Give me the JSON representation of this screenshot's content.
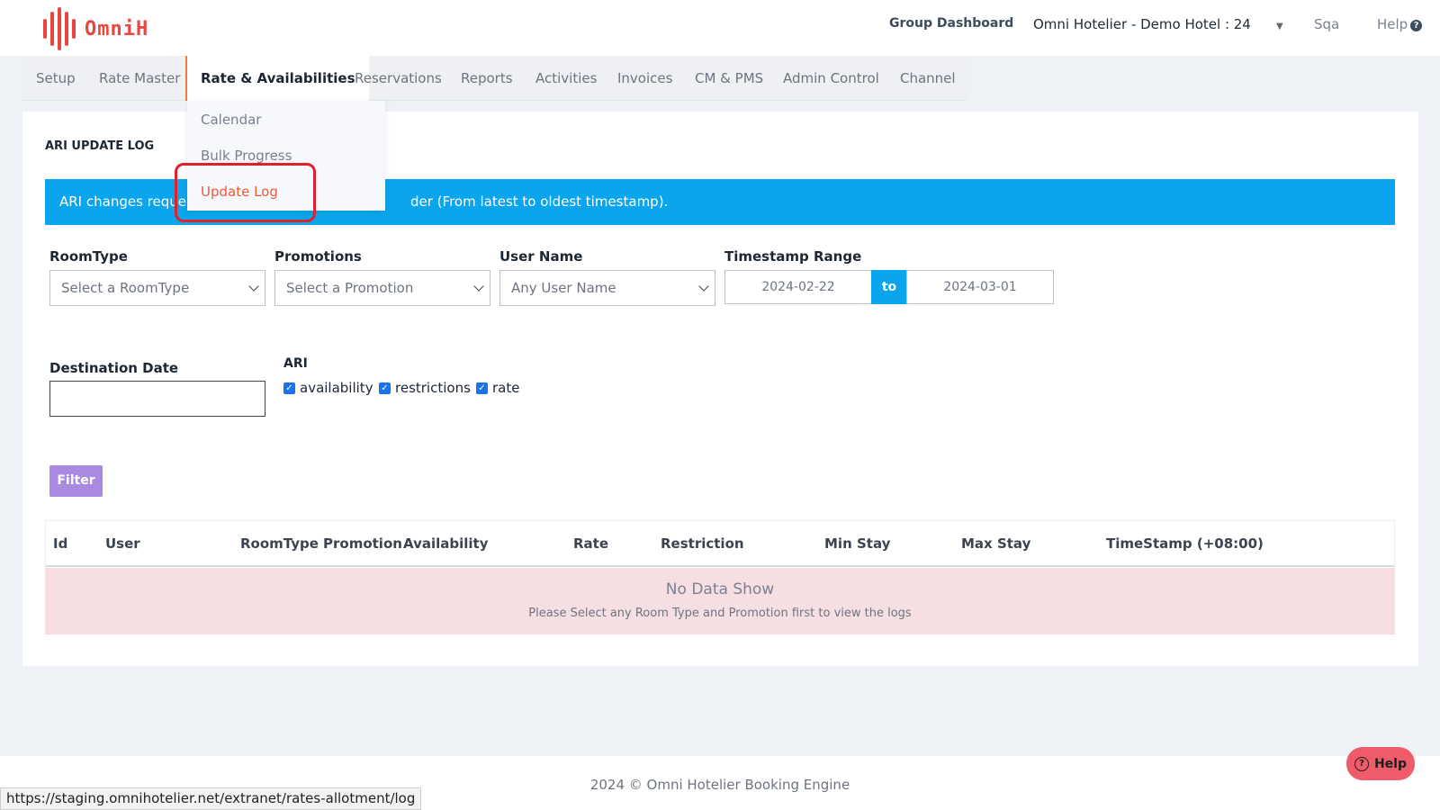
{
  "header": {
    "brand": "OmniH",
    "group_dashboard": "Group Dashboard",
    "hotel_selector": "Omni Hotelier - Demo Hotel : 24",
    "user": "Sqa",
    "help": "Help"
  },
  "nav": {
    "items": [
      "Setup",
      "Rate Master",
      "Rate & Availabilities",
      "Reservations",
      "Reports",
      "Activities",
      "Invoices",
      "CM & PMS",
      "Admin Control",
      "Channel"
    ],
    "active": "Rate & Availabilities"
  },
  "dropdown": {
    "items": [
      "Calendar",
      "Bulk Progress",
      "Update Log"
    ],
    "selected": "Update Log"
  },
  "page": {
    "title": "ARI UPDATE LOG",
    "info_visible_start": "ARI changes reque",
    "info_visible_end": "der (From latest to oldest timestamp)."
  },
  "filters": {
    "roomtype_label": "RoomType",
    "roomtype_value": "Select a RoomType",
    "promotions_label": "Promotions",
    "promotions_value": "Select a Promotion",
    "username_label": "User Name",
    "username_value": "Any User Name",
    "timestamp_label": "Timestamp Range",
    "date_from": "2024-02-22",
    "date_to_label": "to",
    "date_to": "2024-03-01",
    "destination_label": "Destination Date",
    "destination_value": "",
    "ari_label": "ARI",
    "ari_checks": [
      {
        "label": "availability",
        "checked": true
      },
      {
        "label": "restrictions",
        "checked": true
      },
      {
        "label": "rate",
        "checked": true
      }
    ],
    "filter_button": "Filter"
  },
  "table": {
    "columns": [
      "Id",
      "User",
      "RoomType",
      "Promotion",
      "Availability",
      "Rate",
      "Restriction",
      "Min Stay",
      "Max Stay",
      "TimeStamp (+08:00)"
    ],
    "empty_title": "No Data Show",
    "empty_subtitle": "Please Select any Room Type and Promotion first to view the logs"
  },
  "footer": {
    "text": "2024 © Omni Hotelier Booking Engine",
    "status_url": "https://staging.omnihotelier.net/extranet/rates-allotment/log",
    "help_button": "Help"
  },
  "colors": {
    "brand": "#e8473f",
    "info_bar": "#0aa5ec",
    "filter_button": "#a88be0",
    "empty_row": "#f6dfe2",
    "highlight": "#e0202a"
  }
}
